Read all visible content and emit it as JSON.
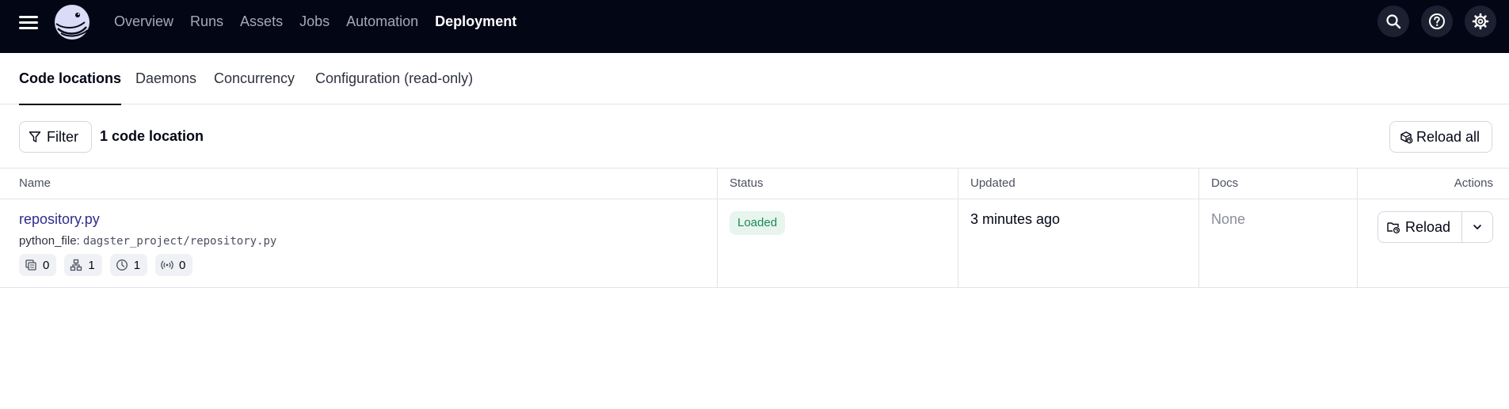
{
  "nav": {
    "items": [
      "Overview",
      "Runs",
      "Assets",
      "Jobs",
      "Automation",
      "Deployment"
    ],
    "active": "Deployment",
    "icons": [
      "search-icon",
      "help-icon",
      "settings-icon"
    ]
  },
  "tabs": {
    "items": [
      "Code locations",
      "Daemons",
      "Concurrency",
      "Configuration (read-only)"
    ],
    "active": "Code locations"
  },
  "toolbar": {
    "filter_label": "Filter",
    "count_label": "1 code location",
    "reload_all_label": "Reload all"
  },
  "table": {
    "headers": [
      "Name",
      "Status",
      "Updated",
      "Docs",
      "Actions"
    ],
    "rows": [
      {
        "name": "repository.py",
        "meta_key": "python_file:",
        "meta_value": "dagster_project/repository.py",
        "counts": {
          "assets": "0",
          "jobs": "1",
          "schedules": "1",
          "sensors": "0"
        },
        "status": "Loaded",
        "updated": "3 minutes ago",
        "docs": "None",
        "action_label": "Reload"
      }
    ]
  },
  "colors": {
    "topbar": "#030615",
    "link": "#2d2c8e",
    "status_bg": "#e7f5ee",
    "status_text": "#1c8a53"
  }
}
